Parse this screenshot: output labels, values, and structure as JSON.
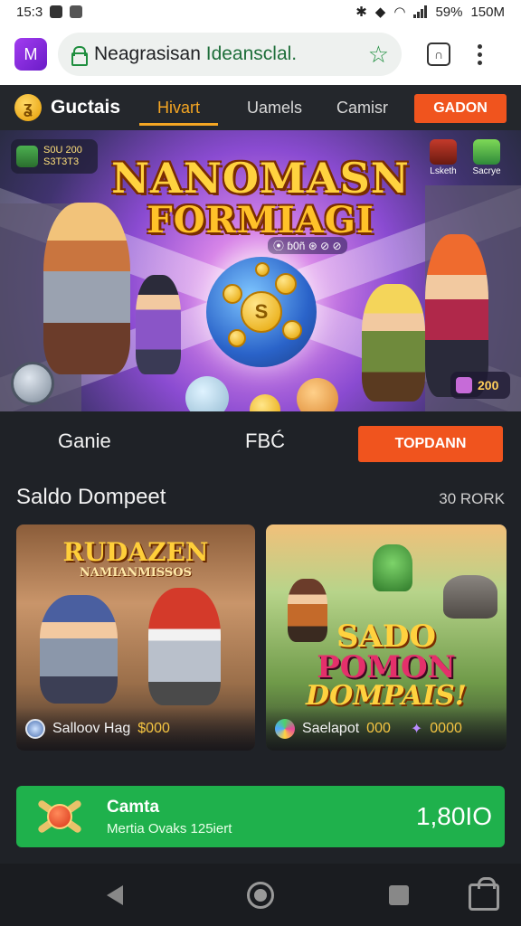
{
  "status_bar": {
    "time": "15:3",
    "battery": "59%",
    "network": "150M"
  },
  "browser": {
    "url_prefix": "Neagrasisan ",
    "url_host": "Ideansclal.",
    "icons": {
      "app": "browser-app-icon",
      "lock": "lock-icon",
      "star": "star-icon",
      "tabs": "tabs-icon",
      "menu": "more-vert-icon"
    }
  },
  "site_nav": {
    "logo": "Guctais",
    "tabs": [
      "Hivart",
      "Uamels",
      "Camisr"
    ],
    "active_tab": 0,
    "cta": "GADON"
  },
  "hero": {
    "title_line1": "NANOMASN",
    "title_line2": "FORMIAGI",
    "sub_badge": "⦿ ɓ0ñ ⊛ ⊘ ⊘",
    "score_line1": "S0U 200",
    "score_line2": "S3T3T3",
    "icon1_label": "Lsketh",
    "icon2_label": "Sacrye",
    "coin_label": "S",
    "chip_value": "200"
  },
  "sub_row": {
    "item1": "Ganie",
    "item2": "FBĆ",
    "button": "TOPDANN"
  },
  "section": {
    "title": "Saldo Dompeet",
    "link": "30 RORK"
  },
  "cards": [
    {
      "art_line1": "RUDAZEN",
      "art_line2": "NAMIANMISSOS",
      "label": "Salloov Hag",
      "value": "$000"
    },
    {
      "art_line1": "SADO",
      "art_line2": "POMON",
      "art_line3": "DOMPAIS!",
      "label": "Saelapot",
      "value": "000",
      "value2": "0000"
    }
  ],
  "promo": {
    "title": "Camta",
    "subtitle": "Mertia Ovaks 125iert",
    "amount": "1,80IO"
  },
  "colors": {
    "accent": "#f0541e",
    "active_tab": "#f5a623",
    "promo_green": "#1fb14c",
    "background": "#1f2227"
  }
}
